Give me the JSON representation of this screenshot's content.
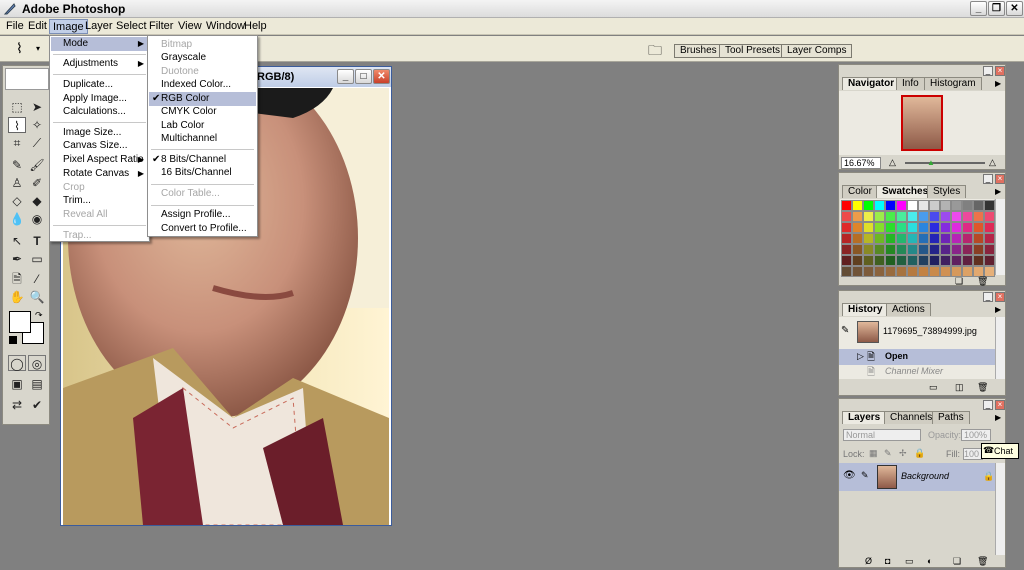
{
  "app": {
    "title": "Adobe Photoshop"
  },
  "menubar": [
    "File",
    "Edit",
    "Image",
    "Layer",
    "Select",
    "Filter",
    "View",
    "Window",
    "Help"
  ],
  "dock": {
    "brushes": "Brushes",
    "tool_presets": "Tool Presets",
    "layer_comps": "Layer Comps"
  },
  "document": {
    "title_fragment": "RGB/8)"
  },
  "image_menu": {
    "items": [
      {
        "label": "Mode",
        "sub": true,
        "highlight": true
      },
      {
        "label": "Adjustments",
        "sub": true
      },
      {
        "label": "Duplicate..."
      },
      {
        "label": "Apply Image..."
      },
      {
        "label": "Calculations..."
      },
      {
        "label": "Image Size..."
      },
      {
        "label": "Canvas Size..."
      },
      {
        "label": "Pixel Aspect Ratio",
        "sub": true
      },
      {
        "label": "Rotate Canvas",
        "sub": true
      },
      {
        "label": "Crop",
        "disabled": true
      },
      {
        "label": "Trim..."
      },
      {
        "label": "Reveal All",
        "disabled": true
      },
      {
        "label": "Trap...",
        "disabled": true
      }
    ]
  },
  "mode_menu": {
    "items": [
      {
        "label": "Bitmap",
        "disabled": true
      },
      {
        "label": "Grayscale"
      },
      {
        "label": "Duotone",
        "disabled": true
      },
      {
        "label": "Indexed Color..."
      },
      {
        "label": "RGB Color",
        "checked": true,
        "highlight": true
      },
      {
        "label": "CMYK Color"
      },
      {
        "label": "Lab Color"
      },
      {
        "label": "Multichannel"
      },
      {
        "label": "8 Bits/Channel",
        "checked": true
      },
      {
        "label": "16 Bits/Channel"
      },
      {
        "label": "Color Table...",
        "disabled": true
      },
      {
        "label": "Assign Profile..."
      },
      {
        "label": "Convert to Profile..."
      }
    ]
  },
  "navigator": {
    "tabs": [
      "Navigator",
      "Info",
      "Histogram"
    ],
    "zoom": "16.67%"
  },
  "color_panel": {
    "tabs": [
      "Color",
      "Swatches",
      "Styles"
    ]
  },
  "history": {
    "tabs": [
      "History",
      "Actions"
    ],
    "snapshot": "1179695_73894999.jpg",
    "items": [
      "Open",
      "Channel Mixer"
    ]
  },
  "layers": {
    "tabs": [
      "Layers",
      "Channels",
      "Paths"
    ],
    "blend": "Normal",
    "opacity_label": "Opacity:",
    "opacity": "100%",
    "lock_label": "Lock:",
    "fill_label": "Fill:",
    "fill": "100",
    "layer_name": "Background",
    "tooltip": "Chat"
  },
  "colors": {
    "accent": "#3b5c9c",
    "highlight": "#b6bed8",
    "panel": "#d8d6cc"
  }
}
